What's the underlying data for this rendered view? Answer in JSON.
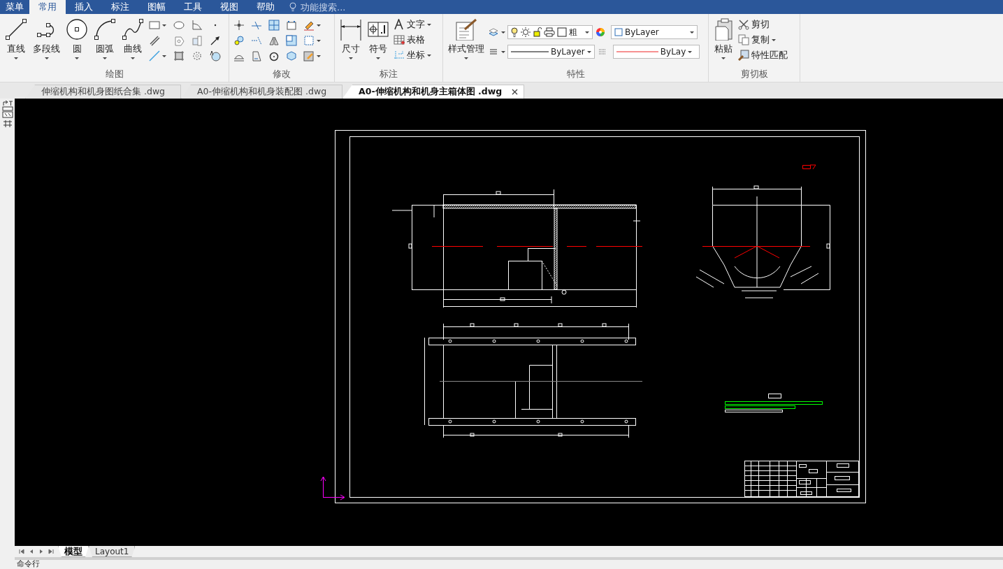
{
  "menu_tabs": [
    {
      "label": "菜单",
      "selected": false
    },
    {
      "label": "常用",
      "selected": true
    },
    {
      "label": "插入",
      "selected": false
    },
    {
      "label": "标注",
      "selected": false
    },
    {
      "label": "图幅",
      "selected": false
    },
    {
      "label": "工具",
      "selected": false
    },
    {
      "label": "视图",
      "selected": false
    },
    {
      "label": "帮助",
      "selected": false
    }
  ],
  "search": {
    "placeholder": "功能搜索..."
  },
  "ribbon": {
    "draw": {
      "title": "绘图",
      "buttons": [
        "直线",
        "多段线",
        "圆",
        "圆弧",
        "曲线"
      ]
    },
    "modify": {
      "title": "修改"
    },
    "annotate": {
      "title": "标注",
      "buttons": [
        "尺寸",
        "符号"
      ],
      "small_buttons": [
        "文字",
        "表格",
        "坐标"
      ]
    },
    "properties": {
      "title": "特性",
      "style_button": "样式管理",
      "layer_value": "粗",
      "color_value": "ByLayer",
      "linetype_value": "ByLayer",
      "lineweight_value": "ByLay"
    },
    "clipboard": {
      "title": "剪切板",
      "paste": "粘贴",
      "small_buttons": [
        "剪切",
        "复制",
        "特性匹配"
      ]
    }
  },
  "document_tabs": [
    {
      "label": "伸缩机构和机身图纸合集 .dwg",
      "selected": false
    },
    {
      "label": "A0-伸缩机构和机身装配图 .dwg",
      "selected": false
    },
    {
      "label": "A0-伸缩机构和机身主箱体图 .dwg",
      "selected": true
    }
  ],
  "layout_tabs": [
    {
      "label": "模型",
      "selected": true
    },
    {
      "label": "Layout1",
      "selected": false
    }
  ],
  "command_line": {
    "label": "命令行"
  }
}
